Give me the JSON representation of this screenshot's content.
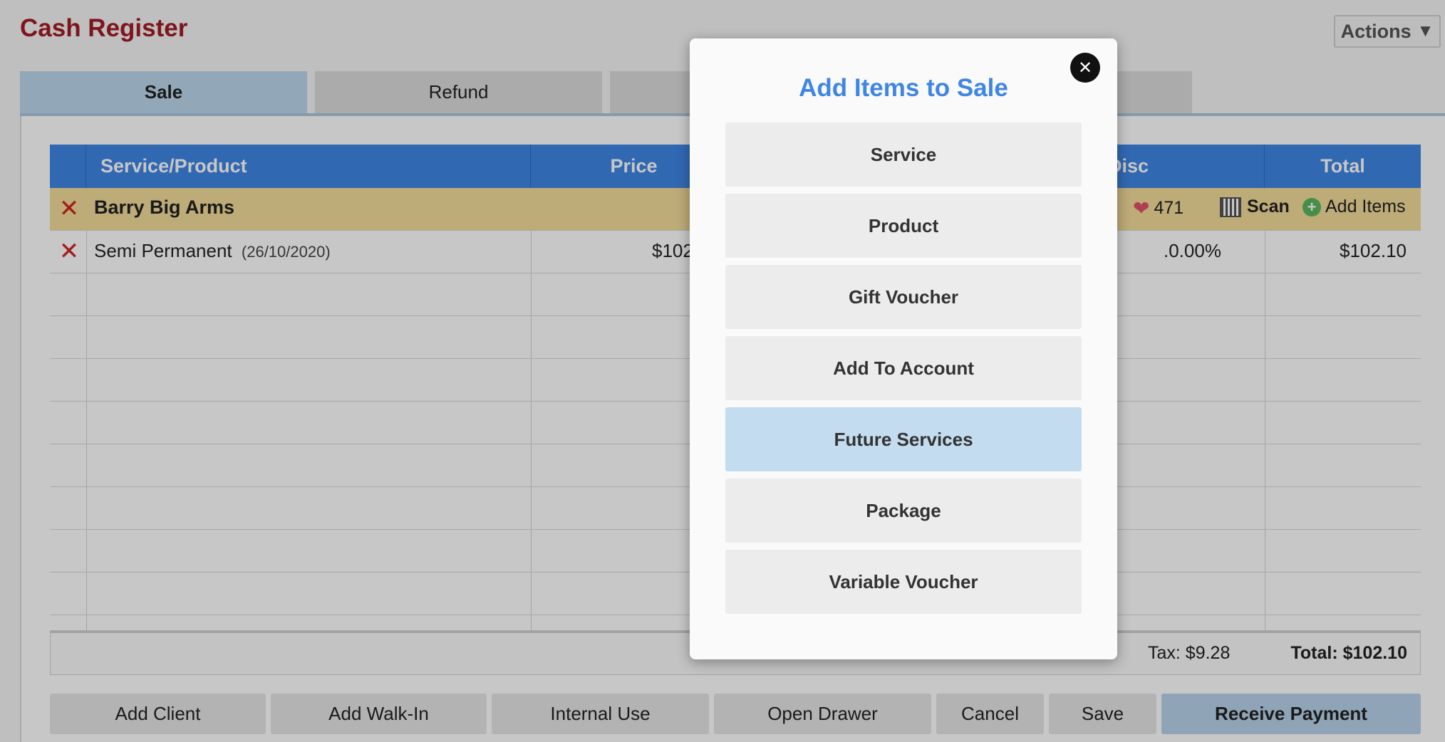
{
  "app": {
    "title": "Cash Register",
    "actions_label": "Actions"
  },
  "tabs": [
    {
      "label": "Sale",
      "active": true
    },
    {
      "label": "Refund",
      "active": false
    },
    {
      "label": "",
      "active": false
    },
    {
      "label": "",
      "active": false
    }
  ],
  "table": {
    "headers": {
      "service_product": "Service/Product",
      "price": "Price",
      "disc": "Disc",
      "total": "Total"
    },
    "client": {
      "name": "Barry Big Arms",
      "points": "471",
      "scan_label": "Scan",
      "add_items_label": "Add Items"
    },
    "items": [
      {
        "name": "Semi Permanent",
        "date": "(26/10/2020)",
        "price": "$102",
        "disc": ".0.00%",
        "total": "$102.10"
      }
    ]
  },
  "summary": {
    "tax": "Tax: $9.28",
    "total": "Total: $102.10"
  },
  "bottom_buttons": {
    "add_client": "Add Client",
    "add_walk_in": "Add Walk-In",
    "internal_use": "Internal Use",
    "open_drawer": "Open Drawer",
    "cancel": "Cancel",
    "save": "Save",
    "receive_payment": "Receive Payment"
  },
  "modal": {
    "title": "Add Items to Sale",
    "options": [
      "Service",
      "Product",
      "Gift Voucher",
      "Add To Account",
      "Future Services",
      "Package",
      "Variable Voucher"
    ],
    "highlighted_option": "Future Services"
  },
  "colors": {
    "brand_red": "#a31b24",
    "header_blue": "#3f86e5",
    "client_row": "#f2dc9a",
    "active_tab": "#bcd6ec",
    "delete_red": "#d02323"
  }
}
